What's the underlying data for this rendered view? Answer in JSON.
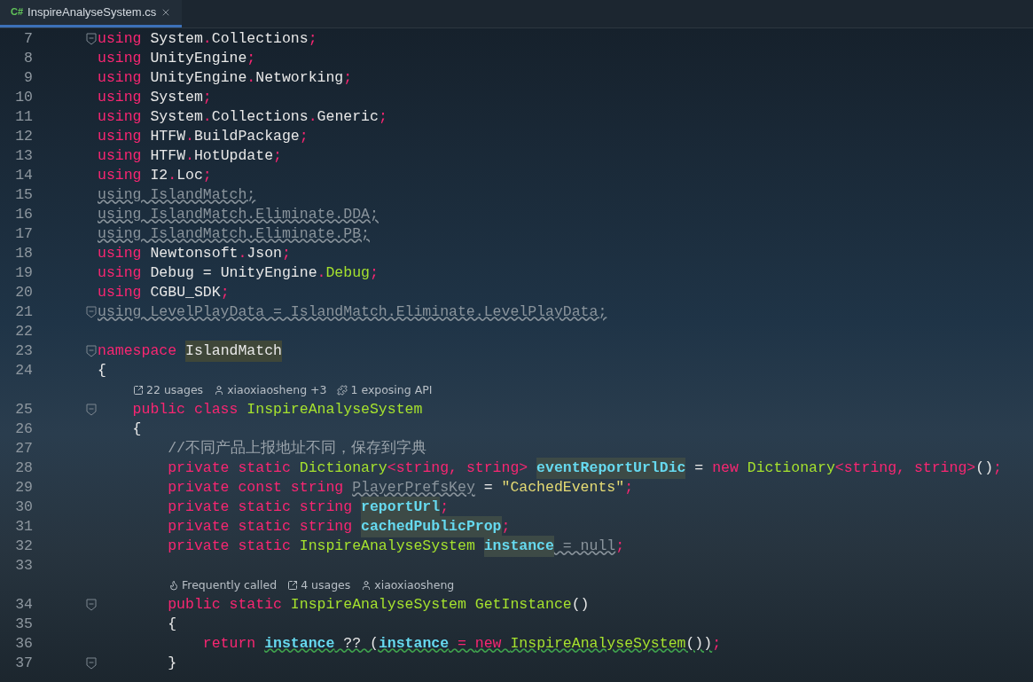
{
  "tab": {
    "badge": "C#",
    "title": "InspireAnalyseSystem.cs",
    "selected": true
  },
  "lines": [
    {
      "kind": "code",
      "number": "7",
      "fold": true,
      "tokens": [
        {
          "text": "using ",
          "kind": "kw"
        },
        {
          "text": "System",
          "kind": "id"
        },
        {
          "text": ".",
          "kind": "p"
        },
        {
          "text": "Collections",
          "kind": "id"
        },
        {
          "text": ";",
          "kind": "p"
        }
      ]
    },
    {
      "kind": "code",
      "number": "8",
      "fold": false,
      "tokens": [
        {
          "text": "using ",
          "kind": "kw"
        },
        {
          "text": "UnityEngine",
          "kind": "id"
        },
        {
          "text": ";",
          "kind": "p"
        }
      ]
    },
    {
      "kind": "code",
      "number": "9",
      "fold": false,
      "tokens": [
        {
          "text": "using ",
          "kind": "kw"
        },
        {
          "text": "UnityEngine",
          "kind": "id"
        },
        {
          "text": ".",
          "kind": "p"
        },
        {
          "text": "Networking",
          "kind": "id"
        },
        {
          "text": ";",
          "kind": "p"
        }
      ]
    },
    {
      "kind": "code",
      "number": "10",
      "fold": false,
      "tokens": [
        {
          "text": "using ",
          "kind": "kw"
        },
        {
          "text": "System",
          "kind": "id"
        },
        {
          "text": ";",
          "kind": "p"
        }
      ]
    },
    {
      "kind": "code",
      "number": "11",
      "fold": false,
      "tokens": [
        {
          "text": "using ",
          "kind": "kw"
        },
        {
          "text": "System",
          "kind": "id"
        },
        {
          "text": ".",
          "kind": "p"
        },
        {
          "text": "Collections",
          "kind": "id"
        },
        {
          "text": ".",
          "kind": "p"
        },
        {
          "text": "Generic",
          "kind": "id"
        },
        {
          "text": ";",
          "kind": "p"
        }
      ]
    },
    {
      "kind": "code",
      "number": "12",
      "fold": false,
      "tokens": [
        {
          "text": "using ",
          "kind": "kw"
        },
        {
          "text": "HTFW",
          "kind": "id"
        },
        {
          "text": ".",
          "kind": "p"
        },
        {
          "text": "BuildPackage",
          "kind": "id"
        },
        {
          "text": ";",
          "kind": "p"
        }
      ]
    },
    {
      "kind": "code",
      "number": "13",
      "fold": false,
      "tokens": [
        {
          "text": "using ",
          "kind": "kw"
        },
        {
          "text": "HTFW",
          "kind": "id"
        },
        {
          "text": ".",
          "kind": "p"
        },
        {
          "text": "HotUpdate",
          "kind": "id"
        },
        {
          "text": ";",
          "kind": "p"
        }
      ]
    },
    {
      "kind": "code",
      "number": "14",
      "fold": false,
      "tokens": [
        {
          "text": "using ",
          "kind": "kw"
        },
        {
          "text": "I2",
          "kind": "id"
        },
        {
          "text": ".",
          "kind": "p"
        },
        {
          "text": "Loc",
          "kind": "id"
        },
        {
          "text": ";",
          "kind": "p"
        }
      ]
    },
    {
      "kind": "code",
      "number": "15",
      "fold": false,
      "tokens": [
        {
          "text": "using IslandMatch;",
          "kind": "dim",
          "squiggle": true
        }
      ]
    },
    {
      "kind": "code",
      "number": "16",
      "fold": false,
      "tokens": [
        {
          "text": "using IslandMatch.Eliminate.DDA;",
          "kind": "dim",
          "squiggle": true
        }
      ]
    },
    {
      "kind": "code",
      "number": "17",
      "fold": false,
      "tokens": [
        {
          "text": "using IslandMatch.Eliminate.PB;",
          "kind": "dim",
          "squiggle": true
        }
      ]
    },
    {
      "kind": "code",
      "number": "18",
      "fold": false,
      "tokens": [
        {
          "text": "using ",
          "kind": "kw"
        },
        {
          "text": "Newtonsoft",
          "kind": "id"
        },
        {
          "text": ".",
          "kind": "p"
        },
        {
          "text": "Json",
          "kind": "id"
        },
        {
          "text": ";",
          "kind": "p"
        }
      ]
    },
    {
      "kind": "code",
      "number": "19",
      "fold": false,
      "tokens": [
        {
          "text": "using ",
          "kind": "kw"
        },
        {
          "text": "Debug = UnityEngine",
          "kind": "id"
        },
        {
          "text": ".",
          "kind": "p"
        },
        {
          "text": "Debug",
          "kind": "type"
        },
        {
          "text": ";",
          "kind": "p"
        }
      ]
    },
    {
      "kind": "code",
      "number": "20",
      "fold": false,
      "tokens": [
        {
          "text": "using ",
          "kind": "kw"
        },
        {
          "text": "CGBU_SDK",
          "kind": "id"
        },
        {
          "text": ";",
          "kind": "p"
        }
      ]
    },
    {
      "kind": "code",
      "number": "21",
      "fold": true,
      "tokens": [
        {
          "text": "using LevelPlayData = IslandMatch.Eliminate.LevelPlayData;",
          "kind": "dim",
          "squiggle": true
        }
      ]
    },
    {
      "kind": "code",
      "number": "22",
      "fold": false
    },
    {
      "kind": "code",
      "number": "23",
      "fold": true,
      "tokens": [
        {
          "text": "namespace ",
          "kind": "kw"
        },
        {
          "text": "IslandMatch",
          "kind": "hl"
        }
      ]
    },
    {
      "kind": "code",
      "number": "24",
      "fold": false,
      "tokens": [
        {
          "text": "{",
          "kind": "id"
        }
      ]
    },
    {
      "kind": "hint",
      "items": [
        {
          "kind": "usages",
          "text": "22 usages"
        },
        {
          "kind": "author",
          "text": "xiaoxiaosheng +3"
        },
        {
          "kind": "api",
          "text": "1 exposing API"
        }
      ]
    },
    {
      "kind": "code",
      "number": "25",
      "fold": true,
      "tokens": [
        {
          "text": "    public class ",
          "kind": "kw"
        },
        {
          "text": "InspireAnalyseSystem",
          "kind": "type"
        }
      ]
    },
    {
      "kind": "code",
      "number": "26",
      "fold": false,
      "tokens": [
        {
          "text": "    {",
          "kind": "id"
        }
      ]
    },
    {
      "kind": "code",
      "number": "27",
      "fold": false,
      "tokens": [
        {
          "text": "        //不同产品上报地址不同，保存到字典",
          "kind": "comment"
        }
      ]
    },
    {
      "kind": "code",
      "number": "28",
      "fold": false,
      "tokens": [
        {
          "text": "        private static ",
          "kind": "kw"
        },
        {
          "text": "Dictionary",
          "kind": "type"
        },
        {
          "text": "<string, string> ",
          "kind": "p"
        },
        {
          "text": "eventReportUrlDic",
          "kind": "field"
        },
        {
          "text": " = ",
          "kind": "id"
        },
        {
          "text": "new ",
          "kind": "kw"
        },
        {
          "text": "Dictionary",
          "kind": "type"
        },
        {
          "text": "<string, string>",
          "kind": "p"
        },
        {
          "text": "()",
          "kind": "id"
        },
        {
          "text": ";",
          "kind": "p"
        }
      ]
    },
    {
      "kind": "code",
      "number": "29",
      "fold": false,
      "tokens": [
        {
          "text": "        private const string ",
          "kind": "kw"
        },
        {
          "text": "PlayerPrefsKey",
          "kind": "dim",
          "squiggle": true
        },
        {
          "text": " = ",
          "kind": "id"
        },
        {
          "text": "\"CachedEvents\"",
          "kind": "str"
        },
        {
          "text": ";",
          "kind": "p"
        }
      ]
    },
    {
      "kind": "code",
      "number": "30",
      "fold": false,
      "tokens": [
        {
          "text": "        private static string ",
          "kind": "kw"
        },
        {
          "text": "reportUrl",
          "kind": "field"
        },
        {
          "text": ";",
          "kind": "p"
        }
      ]
    },
    {
      "kind": "code",
      "number": "31",
      "fold": false,
      "tokens": [
        {
          "text": "        private static string ",
          "kind": "kw"
        },
        {
          "text": "cachedPublicProp",
          "kind": "field"
        },
        {
          "text": ";",
          "kind": "p"
        }
      ]
    },
    {
      "kind": "code",
      "number": "32",
      "fold": false,
      "tokens": [
        {
          "text": "        private static ",
          "kind": "kw"
        },
        {
          "text": "InspireAnalyseSystem ",
          "kind": "type"
        },
        {
          "text": "instance",
          "kind": "field"
        },
        {
          "text": " = null",
          "kind": "dim",
          "squiggle": true
        },
        {
          "text": ";",
          "kind": "p"
        }
      ]
    },
    {
      "kind": "code",
      "number": "33",
      "fold": false
    },
    {
      "kind": "hint",
      "items": [
        {
          "kind": "flame",
          "text": "Frequently called"
        },
        {
          "kind": "usages",
          "text": "4 usages"
        },
        {
          "kind": "author",
          "text": "xiaoxiaosheng"
        }
      ]
    },
    {
      "kind": "code",
      "number": "34",
      "fold": true,
      "tokens": [
        {
          "text": "        public static ",
          "kind": "kw"
        },
        {
          "text": "InspireAnalyseSystem GetInstance",
          "kind": "type"
        },
        {
          "text": "()",
          "kind": "id"
        }
      ]
    },
    {
      "kind": "code",
      "number": "35",
      "fold": false,
      "tokens": [
        {
          "text": "        {",
          "kind": "id"
        }
      ]
    },
    {
      "kind": "code",
      "number": "36",
      "fold": false,
      "tokens": [
        {
          "text": "            return ",
          "kind": "kw"
        },
        {
          "text": "instance",
          "kind": "var",
          "squiggle": true
        },
        {
          "text": " ?? (",
          "kind": "id",
          "squiggle": true
        },
        {
          "text": "instance",
          "kind": "var",
          "squiggle": true
        },
        {
          "text": " = ",
          "kind": "p",
          "squiggle": true
        },
        {
          "text": "new ",
          "kind": "kw",
          "squiggle": true
        },
        {
          "text": "InspireAnalyseSystem",
          "kind": "type",
          "squiggle": true
        },
        {
          "text": "())",
          "kind": "id",
          "squiggle": true
        },
        {
          "text": ";",
          "kind": "p"
        }
      ]
    },
    {
      "kind": "code",
      "number": "37",
      "fold": true,
      "tokens": [
        {
          "text": "        }",
          "kind": "id"
        }
      ]
    }
  ]
}
